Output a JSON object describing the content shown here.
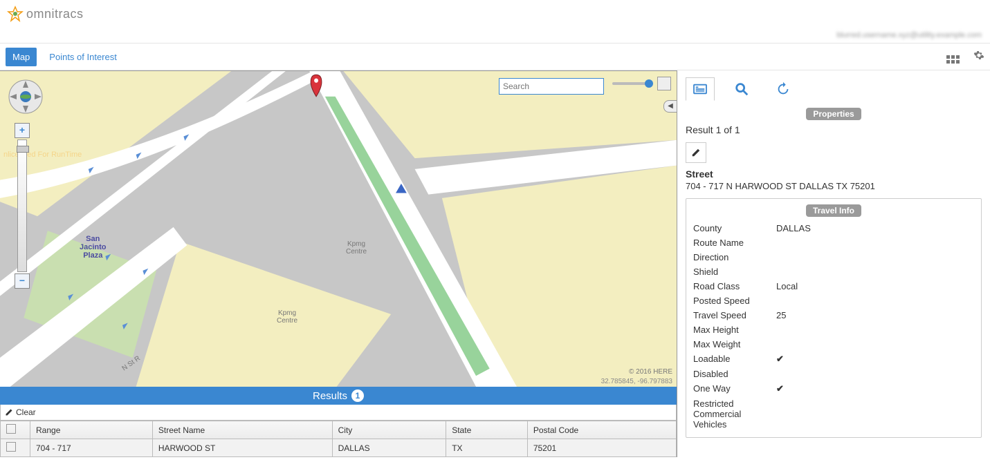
{
  "brand": "omnitracs",
  "nav": {
    "map": "Map",
    "poi": "Points of Interest"
  },
  "map": {
    "search_placeholder": "Search",
    "runtime_text": "nlicensed For RunTime",
    "labels": {
      "plaza": "San\nJacinto\nPlaza",
      "kpmg1": "Kpmg\nCentre",
      "kpmg2": "Kpmg\nCentre",
      "ross": "N St R"
    },
    "attribution": "© 2016 HERE",
    "coords": "32.785845, -96.797883"
  },
  "results": {
    "title": "Results",
    "count": "1",
    "clear": "Clear",
    "headers": {
      "range": "Range",
      "street": "Street Name",
      "city": "City",
      "state": "State",
      "postal": "Postal Code"
    },
    "row": {
      "range": "704 - 717",
      "street": "HARWOOD ST",
      "city": "DALLAS",
      "state": "TX",
      "postal": "75201"
    }
  },
  "panel": {
    "properties_label": "Properties",
    "result_of": "Result 1 of 1",
    "street_label": "Street",
    "address": "704 - 717 N HARWOOD ST DALLAS TX 75201",
    "travel_info_label": "Travel Info",
    "fields": {
      "county": {
        "label": "County",
        "value": "DALLAS"
      },
      "route_name": {
        "label": "Route Name",
        "value": ""
      },
      "direction": {
        "label": "Direction",
        "value": ""
      },
      "shield": {
        "label": "Shield",
        "value": ""
      },
      "road_class": {
        "label": "Road Class",
        "value": "Local"
      },
      "posted_speed": {
        "label": "Posted Speed",
        "value": ""
      },
      "travel_speed": {
        "label": "Travel Speed",
        "value": "25"
      },
      "max_height": {
        "label": "Max Height",
        "value": ""
      },
      "max_weight": {
        "label": "Max Weight",
        "value": ""
      },
      "loadable": {
        "label": "Loadable",
        "value": "✔"
      },
      "disabled": {
        "label": "Disabled",
        "value": ""
      },
      "one_way": {
        "label": "One Way",
        "value": "✔"
      },
      "rcv": {
        "label": "Restricted Commercial Vehicles",
        "value": ""
      }
    }
  },
  "blurred_text": "blurred.username.xyz@utility.example.com"
}
